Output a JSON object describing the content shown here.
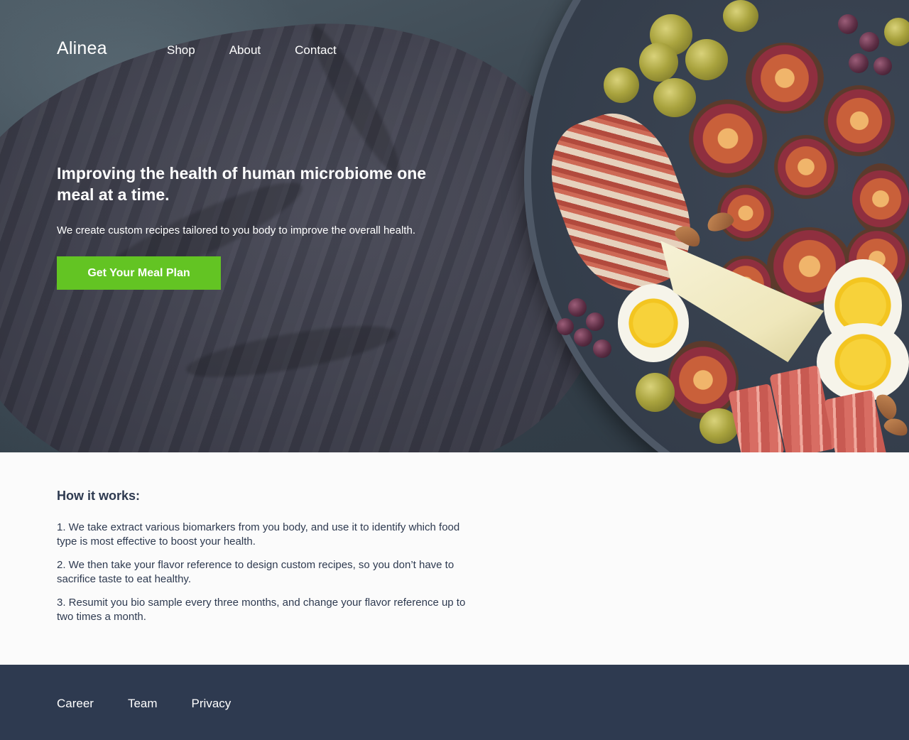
{
  "header": {
    "brand": "Alinea",
    "nav": [
      {
        "label": "Shop"
      },
      {
        "label": "About"
      },
      {
        "label": "Contact"
      }
    ]
  },
  "hero": {
    "headline": "Improving the health of human microbiome one meal at a time.",
    "subline": "We create custom recipes tailored to you body to improve the overall health.",
    "cta_label": "Get Your Meal Plan",
    "cta_color": "#63c423"
  },
  "how_it_works": {
    "title": "How it works:",
    "steps": [
      "1. We take extract various biomarkers from you body, and use it to identify which food type is most effective to boost your health.",
      "2. We then take your flavor reference to design custom recipes, so you don’t have to sacrifice taste to eat healthy.",
      "3. Resumit you bio sample every three months, and change your flavor reference up to two times a month."
    ]
  },
  "footer": {
    "links": [
      {
        "label": "Career"
      },
      {
        "label": "Team"
      },
      {
        "label": "Privacy"
      }
    ],
    "background": "#2e3a50"
  }
}
